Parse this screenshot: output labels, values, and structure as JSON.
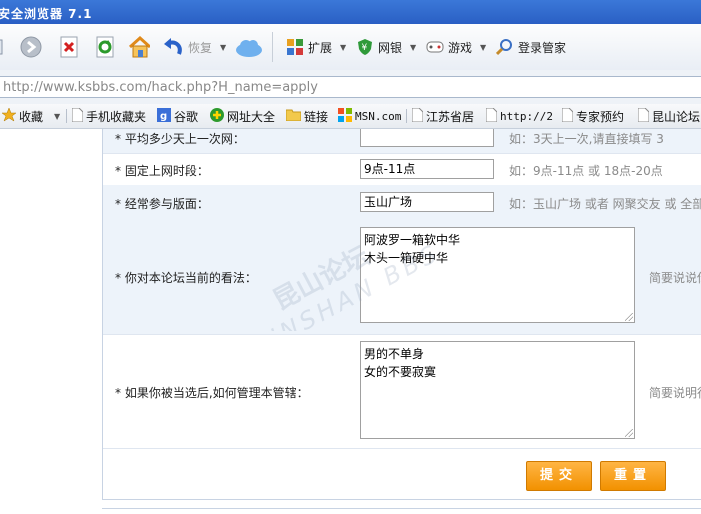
{
  "window": {
    "title": "安全浏览器 7.1"
  },
  "toolbar": {
    "restore_label": "恢复",
    "extend_label": "扩展",
    "netbank_label": "网银",
    "games_label": "游戏",
    "login_label": "登录管家"
  },
  "address": {
    "url": "http://www.ksbbs.com/hack.php?H_name=apply"
  },
  "bookmarks": [
    {
      "label": "收藏",
      "icon": "favorites-star-icon"
    },
    {
      "label": "手机收藏夹",
      "icon": "page-icon"
    },
    {
      "label": "谷歌",
      "icon": "google-icon"
    },
    {
      "label": "网址大全",
      "icon": "plus-circle-icon"
    },
    {
      "label": "链接",
      "icon": "folder-icon"
    },
    {
      "label": "MSN.com",
      "icon": "msn-icon"
    },
    {
      "label": "江苏省居",
      "icon": "page-icon"
    },
    {
      "label": "http://2",
      "icon": "page-icon"
    },
    {
      "label": "专家预约",
      "icon": "page-icon"
    },
    {
      "label": "昆山论坛",
      "icon": "page-icon"
    }
  ],
  "form": {
    "rows": [
      {
        "label": "* 平均多少天上一次网：",
        "value": "",
        "hint": "如：3天上一次,请直接填写 3"
      },
      {
        "label": "* 固定上网时段：",
        "value": "9点-11点",
        "hint": "如：9点-11点 或 18点-20点"
      },
      {
        "label": "* 经常参与版面：",
        "value": "玉山广场",
        "hint": "如：玉山广场 或者 网聚交友 或 全部"
      }
    ],
    "textareas": [
      {
        "label": "* 你对本论坛当前的看法：",
        "lines": [
          "阿波罗一箱软中华",
          "木头一箱硬中华"
        ],
        "hint": "简要说说你"
      },
      {
        "label": "* 如果你被当选后,如何管理本管辖：",
        "lines": [
          "男的不单身",
          "女的不要寂寞"
        ],
        "hint": "简要说明行"
      }
    ],
    "submit_label": "提交",
    "reset_label": "重置"
  },
  "watermark": {
    "line1": "昆山论坛",
    "line2": "KUNSHAN BBS"
  },
  "colors": {
    "accent_orange": "#f29100",
    "panel_alt": "#edf3fa"
  }
}
